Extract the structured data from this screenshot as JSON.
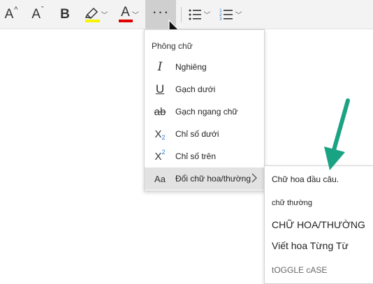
{
  "toolbar": {
    "grow_font": {
      "glyph": "A",
      "sup": "^"
    },
    "shrink_font": {
      "glyph": "A",
      "sup": "ˇ"
    },
    "bold": "B",
    "highlight_color": "#f5f500",
    "font_color_letter": "A",
    "font_color": "#e00000",
    "more": "···"
  },
  "menu": {
    "header": "Phông chữ",
    "items": [
      {
        "icon": "I",
        "label": "Nghiêng"
      },
      {
        "icon": "U",
        "label": "Gạch dưới"
      },
      {
        "icon": "ab",
        "label": "Gạch ngang chữ"
      },
      {
        "icon": "X",
        "sub": "2",
        "label": "Chỉ số dưới"
      },
      {
        "icon": "X",
        "sub": "2",
        "label": "Chỉ số trên"
      },
      {
        "icon": "Aa",
        "label": "Đổi chữ hoa/thường"
      }
    ]
  },
  "submenu": {
    "items": [
      "Chữ hoa đầu câu.",
      "chữ thường",
      "CHỮ HOA/THƯỜNG",
      "Viết hoa Từng Từ",
      "tOGGLE cASE"
    ]
  },
  "colors": {
    "toolbar_bg": "#f3f3f3",
    "active_bg": "#e2e2e2",
    "arrow_green": "#1aa383",
    "subscript_blue": "#2b7bd0"
  }
}
